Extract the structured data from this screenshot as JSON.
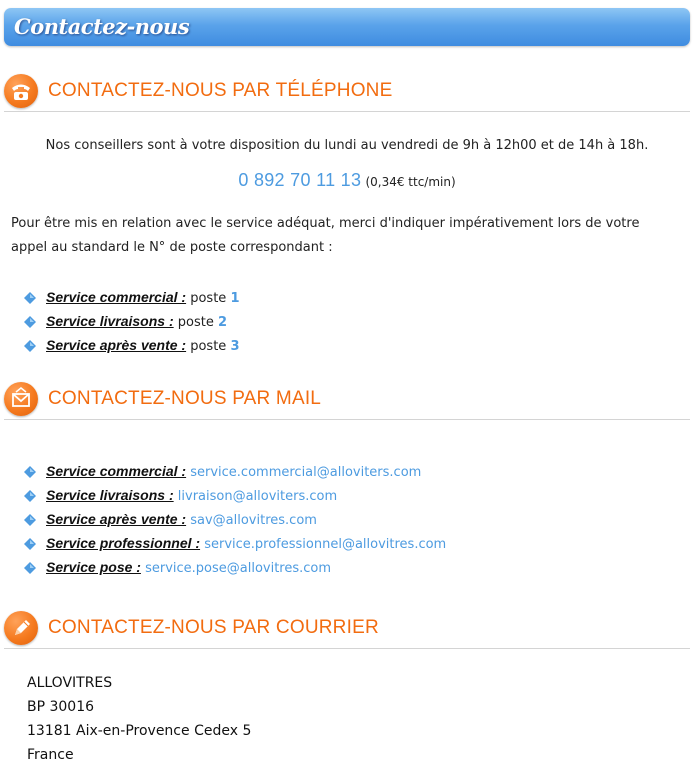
{
  "page_title": "Contactez-nous",
  "phone_section": {
    "icon": "phone-icon",
    "title": "CONTACTEZ-NOUS PAR TÉLÉPHONE",
    "availability": "Nos conseillers sont à votre disposition du lundi au vendredi de 9h à 12h00 et de 14h à 18h.",
    "number": "0 892 70 11 13",
    "price": "(0,34€ ttc/min)",
    "instruction_line1": "Pour être mis en relation avec le service adéquat, merci d'indiquer impérativement lors de votre",
    "instruction_line2": "appel au standard le N° de poste correspondant :",
    "items": [
      {
        "label": "Service commercial :",
        "text": " poste ",
        "value": "1"
      },
      {
        "label": "Service livraisons :",
        "text": " poste ",
        "value": "2"
      },
      {
        "label": "Service après vente :",
        "text": " poste ",
        "value": "3"
      }
    ]
  },
  "mail_section": {
    "icon": "mail-icon",
    "title": "CONTACTEZ-NOUS PAR MAIL",
    "items": [
      {
        "label": "Service commercial :",
        "email": "service.commercial@alloviters.com"
      },
      {
        "label": "Service livraisons :",
        "email": "livraison@alloviters.com"
      },
      {
        "label": "Service après vente :",
        "email": "sav@allovitres.com"
      },
      {
        "label": "Service professionnel :",
        "email": "service.professionnel@allovitres.com"
      },
      {
        "label": "Service pose :",
        "email": "service.pose@allovitres.com"
      }
    ]
  },
  "post_section": {
    "icon": "pen-icon",
    "title": "CONTACTEZ-NOUS PAR COURRIER",
    "address": [
      "ALLOVITRES",
      "BP 30016",
      "13181 Aix-en-Provence Cedex 5",
      "France"
    ]
  },
  "colors": {
    "accent_orange": "#f26c10",
    "link_blue": "#4d9be0",
    "title_bar_blue": "#4f98e6"
  }
}
